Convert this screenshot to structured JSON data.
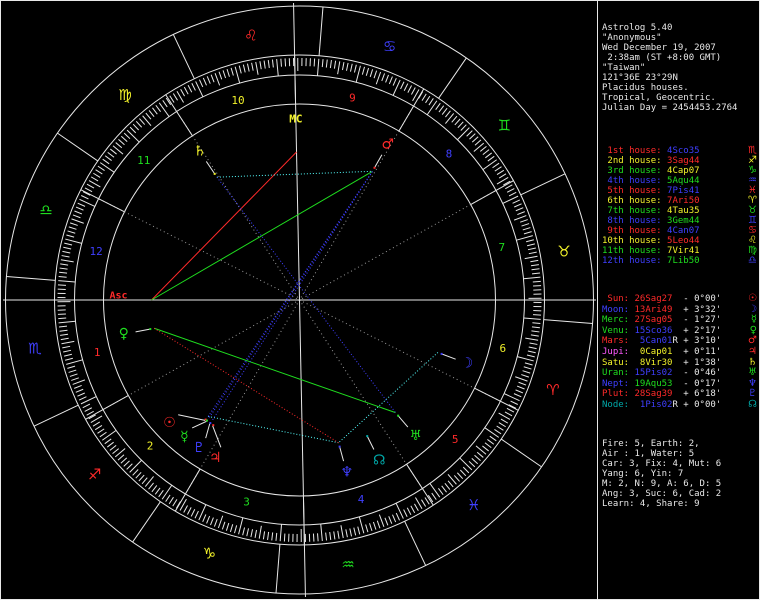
{
  "palette": {
    "red": "#ff2a2a",
    "yellow": "#f2f22a",
    "green": "#1fdd1f",
    "blue": "#3f3fff",
    "magenta": "#ff59ff",
    "teal": "#00a8a8",
    "cyan": "#55ffff",
    "white": "#e8e8e8",
    "gray": "#9a9a9a"
  },
  "panel": {
    "header_lines": [
      "Astrolog 5.40",
      "\"Anonymous\"",
      "Wed December 19, 2007",
      " 2:38am (ST +8:00 GMT)",
      "\"Taiwan\"",
      "121°36E 23°29N",
      "Placidus houses.",
      "Tropical, Geocentric.",
      "Julian Day = 2454453.2764"
    ],
    "houses": [
      {
        "label": " 1st house: ",
        "value": "4Sco35",
        "glyph": "♏",
        "label_color": "red",
        "value_color": "blue",
        "glyph_color": "red"
      },
      {
        "label": " 2nd house: ",
        "value": "3Sag44",
        "glyph": "♐",
        "label_color": "yellow",
        "value_color": "red",
        "glyph_color": "yellow"
      },
      {
        "label": " 3rd house: ",
        "value": "4Cap07",
        "glyph": "♑",
        "label_color": "green",
        "value_color": "yellow",
        "glyph_color": "green"
      },
      {
        "label": " 4th house: ",
        "value": "5Aqu44",
        "glyph": "♒",
        "label_color": "blue",
        "value_color": "green",
        "glyph_color": "blue"
      },
      {
        "label": " 5th house: ",
        "value": "7Pis41",
        "glyph": "♓",
        "label_color": "red",
        "value_color": "blue",
        "glyph_color": "red"
      },
      {
        "label": " 6th house: ",
        "value": "7Ari50",
        "glyph": "♈",
        "label_color": "yellow",
        "value_color": "red",
        "glyph_color": "yellow"
      },
      {
        "label": " 7th house: ",
        "value": "4Tau35",
        "glyph": "♉",
        "label_color": "green",
        "value_color": "yellow",
        "glyph_color": "green"
      },
      {
        "label": " 8th house: ",
        "value": "3Gem44",
        "glyph": "♊",
        "label_color": "blue",
        "value_color": "green",
        "glyph_color": "blue"
      },
      {
        "label": " 9th house: ",
        "value": "4Can07",
        "glyph": "♋",
        "label_color": "red",
        "value_color": "blue",
        "glyph_color": "red"
      },
      {
        "label": "10th house: ",
        "value": "5Leo44",
        "glyph": "♌",
        "label_color": "yellow",
        "value_color": "red",
        "glyph_color": "yellow"
      },
      {
        "label": "11th house: ",
        "value": "7Vir41",
        "glyph": "♍",
        "label_color": "green",
        "value_color": "yellow",
        "glyph_color": "green"
      },
      {
        "label": "12th house: ",
        "value": "7Lib50",
        "glyph": "♎",
        "label_color": "blue",
        "value_color": "green",
        "glyph_color": "blue"
      }
    ],
    "planets": [
      {
        "label": " Sun: ",
        "value": "26Sag27",
        "retro": " ",
        "delta": " - 0°00'",
        "glyph": "☉",
        "label_color": "red",
        "value_color": "red",
        "glyph_color": "red"
      },
      {
        "label": "Moon: ",
        "value": "13Ari49",
        "retro": " ",
        "delta": " + 3°32'",
        "glyph": "☽",
        "label_color": "blue",
        "value_color": "red",
        "glyph_color": "blue"
      },
      {
        "label": "Merc: ",
        "value": "27Sag05",
        "retro": " ",
        "delta": " - 1°27'",
        "glyph": "☿",
        "label_color": "green",
        "value_color": "red",
        "glyph_color": "green"
      },
      {
        "label": "Venu: ",
        "value": "15Sco36",
        "retro": " ",
        "delta": " + 2°17'",
        "glyph": "♀",
        "label_color": "green",
        "value_color": "blue",
        "glyph_color": "green"
      },
      {
        "label": "Mars: ",
        "value": " 5Can01",
        "retro": "R",
        "delta": " + 3°10'",
        "glyph": "♂",
        "label_color": "red",
        "value_color": "blue",
        "glyph_color": "red"
      },
      {
        "label": "Jupi: ",
        "value": " 0Cap01",
        "retro": " ",
        "delta": " + 0°11'",
        "glyph": "♃",
        "label_color": "magenta",
        "value_color": "yellow",
        "glyph_color": "red"
      },
      {
        "label": "Satu: ",
        "value": " 8Vir30",
        "retro": " ",
        "delta": " + 1°38'",
        "glyph": "♄",
        "label_color": "yellow",
        "value_color": "yellow",
        "glyph_color": "yellow"
      },
      {
        "label": "Uran: ",
        "value": "15Pis02",
        "retro": " ",
        "delta": " - 0°46'",
        "glyph": "♅",
        "label_color": "green",
        "value_color": "blue",
        "glyph_color": "green"
      },
      {
        "label": "Nept: ",
        "value": "19Aqu53",
        "retro": " ",
        "delta": " - 0°17'",
        "glyph": "♆",
        "label_color": "blue",
        "value_color": "green",
        "glyph_color": "blue"
      },
      {
        "label": "Plut: ",
        "value": "28Sag39",
        "retro": " ",
        "delta": " + 6°18'",
        "glyph": "♇",
        "label_color": "red",
        "value_color": "red",
        "glyph_color": "blue"
      },
      {
        "label": "Node: ",
        "value": " 1Pis02",
        "retro": "R",
        "delta": " + 0°00'",
        "glyph": "☊",
        "label_color": "teal",
        "value_color": "blue",
        "glyph_color": "teal"
      }
    ],
    "stats_lines": [
      "Fire: 5, Earth: 2,",
      "Air : 1, Water: 5",
      "Car: 3, Fix: 4, Mut: 6",
      "Yang: 6, Yin: 7",
      "M: 2, N: 9, A: 6, D: 5",
      "Ang: 3, Suc: 6, Cad: 2",
      "Learn: 4, Share: 9"
    ]
  },
  "wheel": {
    "asc_lon": 214.583,
    "asc_label": "Asc",
    "mc_label": "MC",
    "mc_lon": 125.733,
    "signs": [
      {
        "name": "aries",
        "glyph": "♈",
        "color": "red"
      },
      {
        "name": "taurus",
        "glyph": "♉",
        "color": "yellow"
      },
      {
        "name": "gemini",
        "glyph": "♊",
        "color": "green"
      },
      {
        "name": "cancer",
        "glyph": "♋",
        "color": "blue"
      },
      {
        "name": "leo",
        "glyph": "♌",
        "color": "red"
      },
      {
        "name": "virgo",
        "glyph": "♍",
        "color": "yellow"
      },
      {
        "name": "libra",
        "glyph": "♎",
        "color": "green"
      },
      {
        "name": "scorpio",
        "glyph": "♏",
        "color": "blue"
      },
      {
        "name": "sagittarius",
        "glyph": "♐",
        "color": "red"
      },
      {
        "name": "capricorn",
        "glyph": "♑",
        "color": "yellow"
      },
      {
        "name": "aquarius",
        "glyph": "♒",
        "color": "green"
      },
      {
        "name": "pisces",
        "glyph": "♓",
        "color": "blue"
      }
    ],
    "house_cusps": [
      214.583,
      243.733,
      274.117,
      305.733,
      337.683,
      7.833,
      34.583,
      63.733,
      94.117,
      125.733,
      157.683,
      187.833
    ],
    "house_number_colors": [
      "red",
      "yellow",
      "green",
      "blue",
      "red",
      "yellow",
      "green",
      "blue",
      "red",
      "yellow",
      "green",
      "blue"
    ],
    "planets": [
      {
        "name": "sun",
        "glyph": "☉",
        "color": "red",
        "lon": 266.45,
        "display_lon": 258.0
      },
      {
        "name": "moon",
        "glyph": "☽",
        "color": "blue",
        "lon": 13.817,
        "display_lon": 13.817
      },
      {
        "name": "mercury",
        "glyph": "☿",
        "color": "green",
        "lon": 267.083,
        "display_lon": 264.6
      },
      {
        "name": "venus",
        "glyph": "♀",
        "color": "green",
        "lon": 225.6,
        "display_lon": 225.6
      },
      {
        "name": "mars",
        "glyph": "♂",
        "color": "red",
        "lon": 95.017,
        "display_lon": 95.017
      },
      {
        "name": "jupiter",
        "glyph": "♃",
        "color": "red",
        "lon": 270.017,
        "display_lon": 276.5
      },
      {
        "name": "saturn",
        "glyph": "♄",
        "color": "yellow",
        "lon": 158.5,
        "display_lon": 158.5
      },
      {
        "name": "uranus",
        "glyph": "♅",
        "color": "green",
        "lon": 345.033,
        "display_lon": 345.033
      },
      {
        "name": "neptune",
        "glyph": "♆",
        "color": "blue",
        "lon": 319.883,
        "display_lon": 319.883
      },
      {
        "name": "pluto",
        "glyph": "♇",
        "color": "blue",
        "lon": 268.65,
        "display_lon": 270.4
      },
      {
        "name": "node",
        "glyph": "☊",
        "color": "teal",
        "lon": 331.033,
        "display_lon": 331.033
      }
    ],
    "aspects": [
      {
        "a": "asc",
        "b": "mc",
        "type": "square",
        "color": "red",
        "style": "solid"
      },
      {
        "a": "asc",
        "b": "mars",
        "type": "trine",
        "color": "green",
        "style": "solid"
      },
      {
        "a": "venus",
        "b": "uranus",
        "type": "trine",
        "color": "green",
        "style": "solid"
      },
      {
        "a": "saturn",
        "b": "mars",
        "type": "sextile",
        "color": "cyan",
        "style": "dotted"
      },
      {
        "a": "sun",
        "b": "neptune",
        "type": "sextile",
        "color": "cyan",
        "style": "dotted"
      },
      {
        "a": "moon",
        "b": "neptune",
        "type": "sextile",
        "color": "cyan",
        "style": "dotted"
      },
      {
        "a": "sun",
        "b": "mars",
        "type": "opposition",
        "color": "blue",
        "style": "dotted"
      },
      {
        "a": "mercury",
        "b": "mars",
        "type": "opposition",
        "color": "blue",
        "style": "dotted"
      },
      {
        "a": "pluto",
        "b": "mars",
        "type": "opposition",
        "color": "blue",
        "style": "dotted"
      },
      {
        "a": "saturn",
        "b": "uranus",
        "type": "opposition",
        "color": "blue",
        "style": "dotted"
      },
      {
        "a": "venus",
        "b": "neptune",
        "type": "square",
        "color": "red",
        "style": "dotted"
      }
    ]
  }
}
